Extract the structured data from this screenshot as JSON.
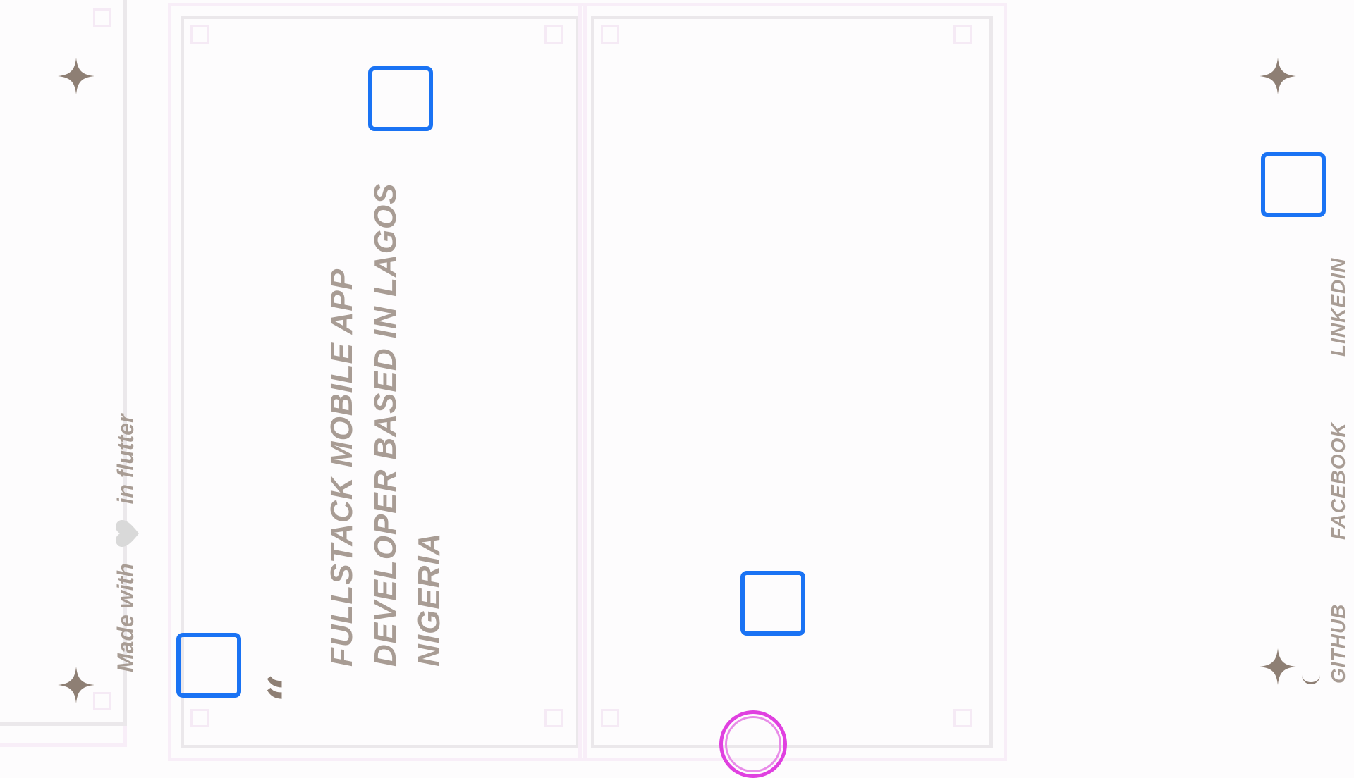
{
  "footer_credit": {
    "prefix": "Made with",
    "suffix": "in flutter",
    "heart_icon": "heart-icon",
    "heart_color": "#d9d9d9"
  },
  "hero": {
    "quote_icon": "quote-open-icon",
    "headline_lines": [
      "FULLSTACK MOBILE APP",
      "DEVELOPER BASED IN LAGOS",
      "NIGERIA"
    ]
  },
  "social_links": [
    {
      "label": "LINKEDIN"
    },
    {
      "label": "FACEBOOK"
    },
    {
      "label": "GITHUB"
    }
  ],
  "colors": {
    "text": "#a89c94",
    "sparkle": "#8e7f74",
    "accent_box": "#1a73f4",
    "ring": "#e040e0",
    "background": "#fdfcfd"
  }
}
